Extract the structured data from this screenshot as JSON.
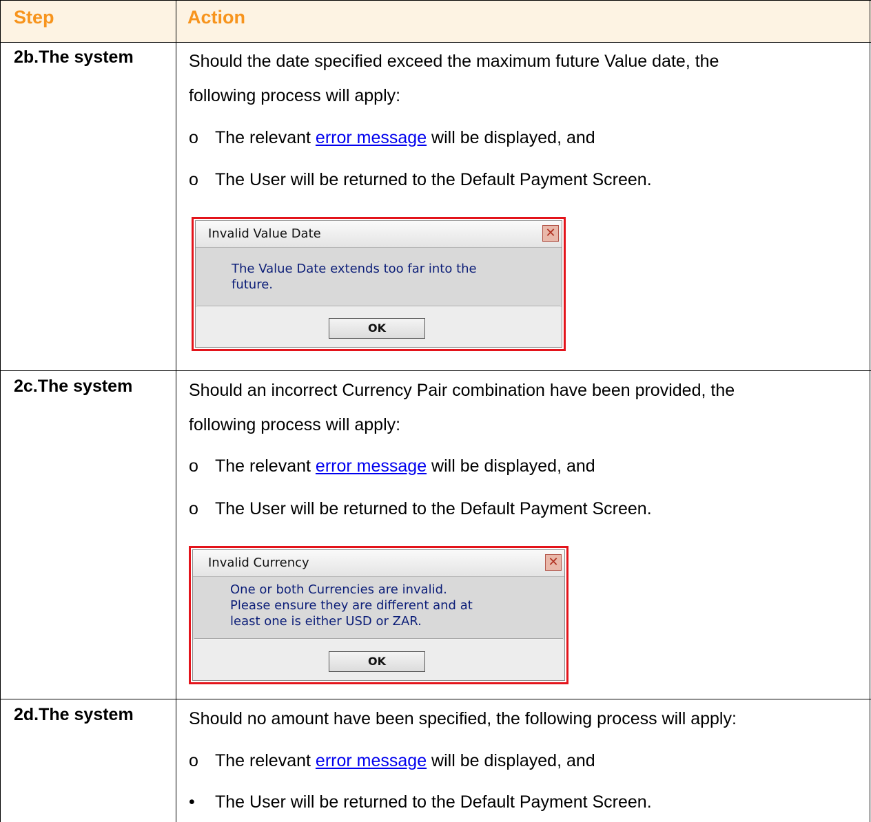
{
  "header": {
    "step": "Step",
    "action": "Action"
  },
  "rows": [
    {
      "step": "2b.The system",
      "text_line1": "Should the date specified exceed the maximum future Value date, the",
      "text_line2": "following process will apply:",
      "bullet1": {
        "marker": "o",
        "pre": "The relevant ",
        "link": "error message",
        "post": " will be displayed, and"
      },
      "bullet2": {
        "marker": "o",
        "text": "The User will be returned to the Default Payment Screen."
      },
      "dialog": {
        "title": "Invalid Value Date",
        "close": "✕",
        "message": "The Value Date extends too far into the\nfuture.",
        "ok": "OK"
      }
    },
    {
      "step": "2c.The system",
      "text_line1": "Should an incorrect Currency Pair combination have been provided, the",
      "text_line2": "following process will apply:",
      "bullet1": {
        "marker": "o",
        "pre": "The relevant ",
        "link": "error message",
        "post": " will be displayed, and"
      },
      "bullet2": {
        "marker": "o",
        "text": "The User will be returned to the Default Payment Screen."
      },
      "dialog": {
        "title": "Invalid Currency",
        "close": "✕",
        "message": "One or both Currencies are invalid.\nPlease ensure they are different and at\nleast one is either USD or ZAR.",
        "ok": "OK"
      }
    },
    {
      "step": "2d.The system",
      "text_line1": "Should no amount have been specified, the following process will apply:",
      "bullet1": {
        "marker": "o",
        "pre": "The relevant ",
        "link": "error message",
        "post": " will be displayed, and"
      },
      "bullet2": {
        "marker": "•",
        "text": "The User will be returned to the Default Payment Screen."
      }
    }
  ],
  "colors": {
    "header_text": "#f7941d",
    "link": "#0000ee",
    "dialog_border": "#e3141b",
    "dialog_text": "#0c1e78"
  }
}
